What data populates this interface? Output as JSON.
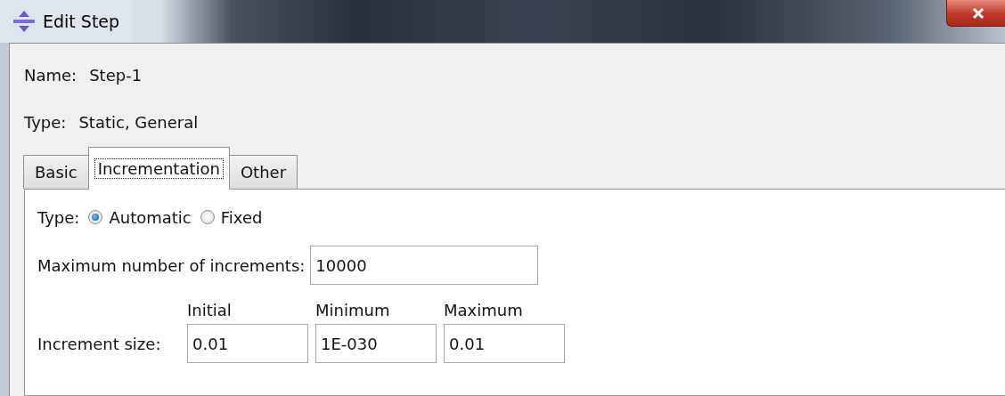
{
  "window": {
    "title": "Edit Step"
  },
  "name": {
    "label": "Name:",
    "value": "Step-1"
  },
  "type": {
    "label": "Type:",
    "value": "Static, General"
  },
  "tabs": [
    {
      "label": "Basic",
      "selected": false
    },
    {
      "label": "Incrementation",
      "selected": true
    },
    {
      "label": "Other",
      "selected": false
    }
  ],
  "incrementation": {
    "type_label": "Type:",
    "type_options": [
      {
        "label": "Automatic",
        "selected": true
      },
      {
        "label": "Fixed",
        "selected": false
      }
    ],
    "max_increments": {
      "label": "Maximum number of increments:",
      "value": "10000"
    },
    "increment_size": {
      "label": "Increment size:",
      "columns": [
        "Initial",
        "Minimum",
        "Maximum"
      ],
      "values": [
        "0.01",
        "1E-030",
        "0.01"
      ]
    }
  }
}
